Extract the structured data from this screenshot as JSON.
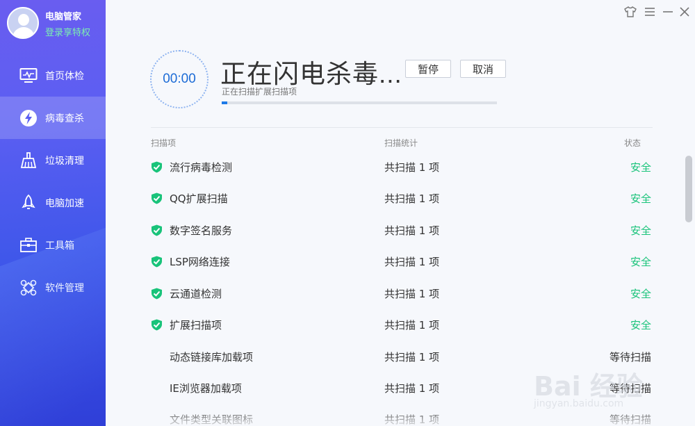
{
  "profile": {
    "name": "电脑管家",
    "login_link": "登录享特权"
  },
  "sidebar": {
    "items": [
      {
        "label": "首页体检",
        "icon": "monitor-icon",
        "active": false
      },
      {
        "label": "病毒查杀",
        "icon": "lightning-shield-icon",
        "active": true
      },
      {
        "label": "垃圾清理",
        "icon": "broom-icon",
        "active": false
      },
      {
        "label": "电脑加速",
        "icon": "rocket-icon",
        "active": false
      },
      {
        "label": "工具箱",
        "icon": "toolbox-icon",
        "active": false
      },
      {
        "label": "软件管理",
        "icon": "apps-icon",
        "active": false
      }
    ]
  },
  "window_controls": [
    "skin-icon",
    "menu-icon",
    "minimize-icon",
    "close-icon"
  ],
  "scan": {
    "timer": "00:00",
    "title": "正在闪电杀毒...",
    "pause_label": "暂停",
    "cancel_label": "取消",
    "current_item": "正在扫描扩展扫描项",
    "progress_percent": 2
  },
  "table": {
    "headers": {
      "item": "扫描项",
      "stats": "扫描统计",
      "status": "状态"
    },
    "rows": [
      {
        "name": "流行病毒检测",
        "stats": "共扫描 1 项",
        "status": "安全",
        "checked": true
      },
      {
        "name": "QQ扩展扫描",
        "stats": "共扫描 1 项",
        "status": "安全",
        "checked": true
      },
      {
        "name": "数字签名服务",
        "stats": "共扫描 1 项",
        "status": "安全",
        "checked": true
      },
      {
        "name": "LSP网络连接",
        "stats": "共扫描 1 项",
        "status": "安全",
        "checked": true
      },
      {
        "name": "云通道检测",
        "stats": "共扫描 1 项",
        "status": "安全",
        "checked": true
      },
      {
        "name": "扩展扫描项",
        "stats": "共扫描 1 项",
        "status": "安全",
        "checked": true
      },
      {
        "name": "动态链接库加载项",
        "stats": "共扫描 1 项",
        "status": "等待扫描",
        "checked": false
      },
      {
        "name": "IE浏览器加载项",
        "stats": "共扫描 1 项",
        "status": "等待扫描",
        "checked": false
      },
      {
        "name": "文件类型关联图标",
        "stats": "共扫描 1 项",
        "status": "等待扫描",
        "checked": false
      }
    ]
  },
  "watermark": {
    "text": "Bai 经验",
    "sub": "jingyan.baidu.com"
  },
  "colors": {
    "accent": "#1d7ae8",
    "safe": "#19c37a",
    "sidebar_top": "#6a5df0",
    "sidebar_bottom": "#2f3fd8"
  }
}
